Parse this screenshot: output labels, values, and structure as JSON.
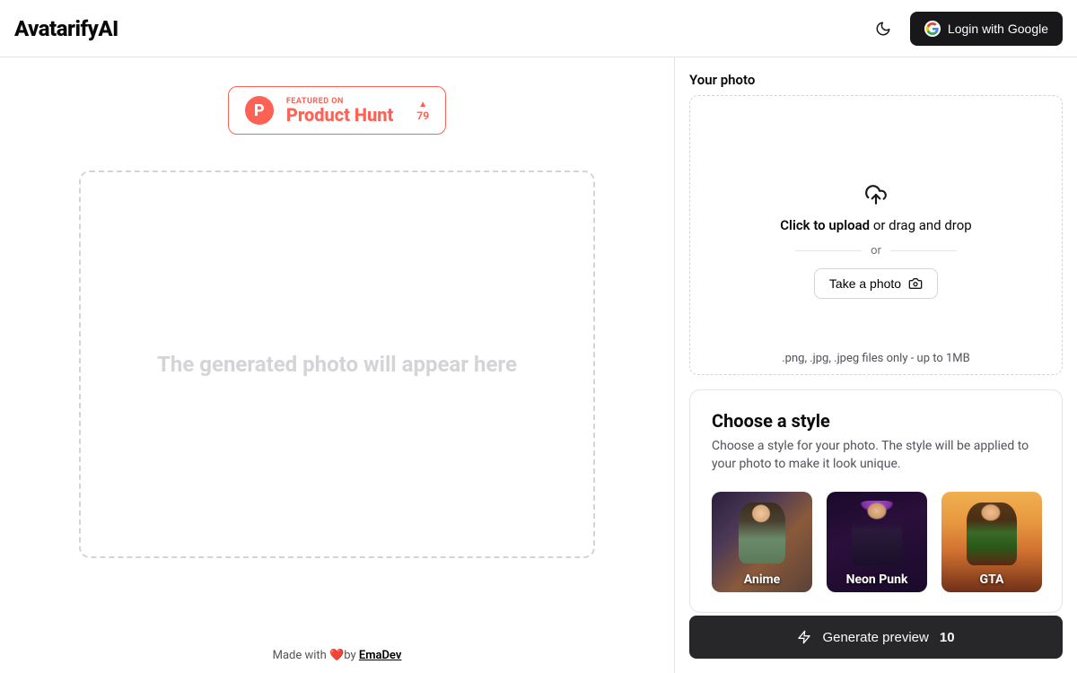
{
  "header": {
    "brand": "AvatarifyAI",
    "login_label": "Login with Google"
  },
  "ph": {
    "top": "FEATURED ON",
    "title": "Product Hunt",
    "votes": "79"
  },
  "preview": {
    "placeholder": "The generated photo will appear here"
  },
  "footer": {
    "made_prefix": "Made with ❤️by ",
    "author": "EmaDev"
  },
  "upload": {
    "section_label": "Your photo",
    "click_bold": "Click to upload",
    "click_rest": " or drag and drop",
    "or": "or",
    "take_photo": "Take a photo",
    "note": ".png, .jpg, .jpeg files only - up to 1MB"
  },
  "style": {
    "title": "Choose a style",
    "desc": "Choose a style for your photo. The style will be applied to your photo to make it look unique.",
    "items": [
      "Anime",
      "Neon Punk",
      "GTA"
    ]
  },
  "generate": {
    "label": "Generate preview",
    "count": "10"
  }
}
